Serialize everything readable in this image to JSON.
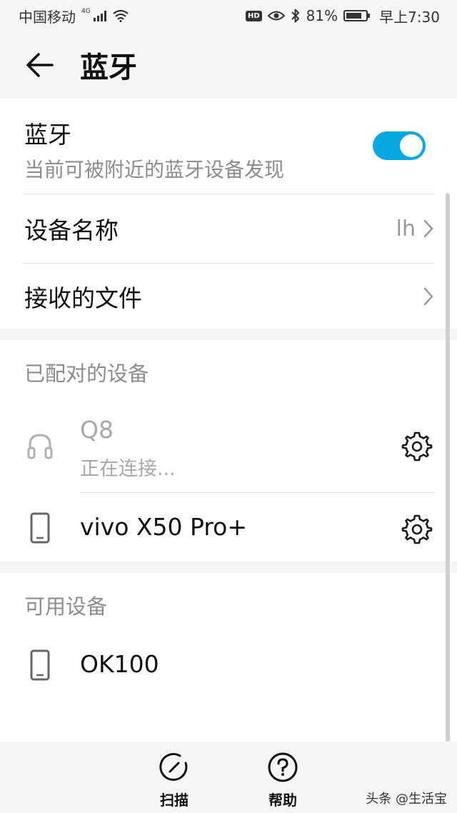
{
  "status_bar": {
    "carrier": "中国移动",
    "network": "4G",
    "hd": "HD",
    "battery": "81%",
    "battery_level": 0.81,
    "time": "早上7:30"
  },
  "header": {
    "title": "蓝牙"
  },
  "bluetooth": {
    "title": "蓝牙",
    "subtitle": "当前可被附近的蓝牙设备发现",
    "enabled": true
  },
  "device_name": {
    "label": "设备名称",
    "value": "lh"
  },
  "received_files": {
    "label": "接收的文件"
  },
  "paired": {
    "title": "已配对的设备",
    "devices": [
      {
        "name": "Q8",
        "status": "正在连接...",
        "icon": "headset-icon"
      },
      {
        "name": "vivo X50 Pro+",
        "icon": "phone-icon"
      }
    ]
  },
  "available": {
    "title": "可用设备",
    "devices": [
      {
        "name": "OK100",
        "icon": "phone-icon"
      }
    ]
  },
  "bottom_bar": {
    "scan": "扫描",
    "help": "帮助"
  },
  "watermark": "头条 @生活宝",
  "colors": {
    "accent": "#05a8e3"
  }
}
